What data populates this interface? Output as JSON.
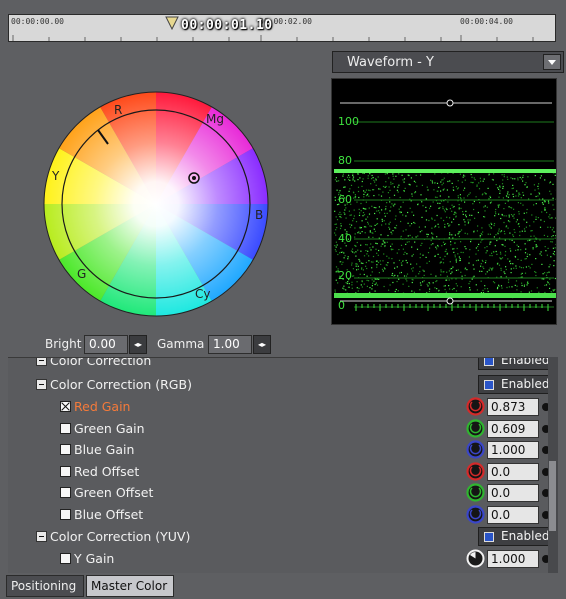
{
  "timeline": {
    "marks": [
      "00:00:00.00",
      "00:00:02.00",
      "00:00:04.00"
    ],
    "current_time": "00:00:01.10"
  },
  "color_wheel": {
    "labels": {
      "r": "R",
      "mg": "Mg",
      "b": "B",
      "cy": "Cy",
      "g": "G",
      "y": "Y"
    }
  },
  "waveform": {
    "mode": "Waveform - Y",
    "scale_labels": [
      "100",
      "80",
      "60",
      "40",
      "20",
      "0"
    ]
  },
  "adjust": {
    "bright_label": "Bright",
    "bright_value": "0.00",
    "gamma_label": "Gamma",
    "gamma_value": "1.00",
    "stepper_glyph": "◂▸"
  },
  "properties": {
    "partial_group_label": "Color Correction",
    "partial_group_enabled": "Enabled",
    "rgb_group": {
      "label": "Color Correction (RGB)",
      "enabled": "Enabled",
      "items": [
        {
          "label": "Red Gain",
          "value": "0.873",
          "knob_color": "#d42a2a",
          "checked": true,
          "active": true
        },
        {
          "label": "Green Gain",
          "value": "0.609",
          "knob_color": "#2fb52f",
          "checked": false,
          "active": false
        },
        {
          "label": "Blue Gain",
          "value": "1.000",
          "knob_color": "#3a46c8",
          "checked": false,
          "active": false
        },
        {
          "label": "Red Offset",
          "value": "0.0",
          "knob_color": "#d42a2a",
          "checked": false,
          "active": false
        },
        {
          "label": "Green Offset",
          "value": "0.0",
          "knob_color": "#2fb52f",
          "checked": false,
          "active": false
        },
        {
          "label": "Blue Offset",
          "value": "0.0",
          "knob_color": "#3a46c8",
          "checked": false,
          "active": false
        }
      ]
    },
    "yuv_group": {
      "label": "Color Correction (YUV)",
      "enabled": "Enabled",
      "items": [
        {
          "label": "Y Gain",
          "value": "1.000",
          "knob_color": "#f2f2f2"
        }
      ]
    }
  },
  "tabs": [
    "Positioning",
    "Master Color"
  ],
  "colors": {
    "accent": "#f57a3a",
    "waveform": "#3fe23f",
    "enabled_box": "#2a55c8"
  }
}
